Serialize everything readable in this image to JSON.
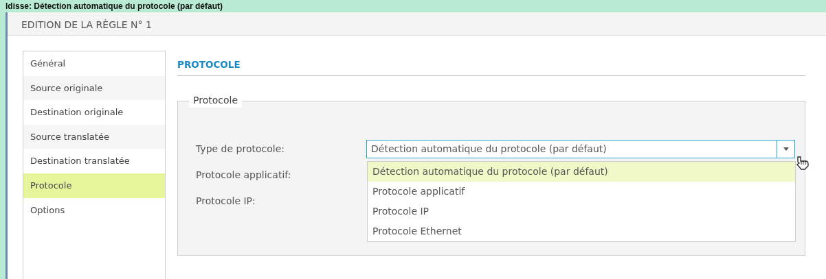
{
  "caption": "ldisse: Détection automatique du protocole (par défaut)",
  "window": {
    "title": "EDITION DE LA RÈGLE N° 1"
  },
  "sidebar": {
    "items": [
      {
        "label": "Général",
        "selected": false
      },
      {
        "label": "Source originale",
        "selected": false
      },
      {
        "label": "Destination originale",
        "selected": false
      },
      {
        "label": "Source translatée",
        "selected": false
      },
      {
        "label": "Destination translatée",
        "selected": false
      },
      {
        "label": "Protocole",
        "selected": true
      },
      {
        "label": "Options",
        "selected": false
      }
    ]
  },
  "section": {
    "heading": "PROTOCOLE",
    "fieldset": {
      "legend": "Protocole",
      "fields": [
        {
          "label": "Type de protocole:",
          "value": "Détection automatique du protocole (par défaut)"
        },
        {
          "label": "Protocole applicatif:"
        },
        {
          "label": "Protocole IP:"
        }
      ],
      "dropdown": {
        "options": [
          {
            "label": "Détection automatique du protocole (par défaut)",
            "selected": true
          },
          {
            "label": "Protocole applicatif",
            "selected": false
          },
          {
            "label": "Protocole IP",
            "selected": false
          },
          {
            "label": "Protocole Ethernet",
            "selected": false
          }
        ]
      }
    }
  }
}
